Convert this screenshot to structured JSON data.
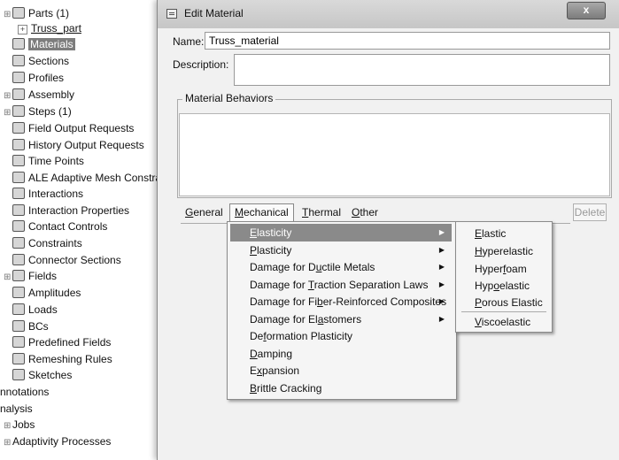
{
  "tree": {
    "items": [
      {
        "label": "Parts (1)",
        "expander": "⊞"
      },
      {
        "label": "Truss_part"
      },
      {
        "label": "Materials"
      },
      {
        "label": "Sections"
      },
      {
        "label": "Profiles"
      },
      {
        "label": "Assembly"
      },
      {
        "label": "Steps (1)"
      },
      {
        "label": "Field Output Requests"
      },
      {
        "label": "History Output Requests"
      },
      {
        "label": "Time Points"
      },
      {
        "label": "ALE Adaptive Mesh Constra"
      },
      {
        "label": "Interactions"
      },
      {
        "label": "Interaction Properties"
      },
      {
        "label": "Contact Controls"
      },
      {
        "label": "Constraints"
      },
      {
        "label": "Connector Sections"
      },
      {
        "label": "Fields"
      },
      {
        "label": "Amplitudes"
      },
      {
        "label": "Loads"
      },
      {
        "label": "BCs"
      },
      {
        "label": "Predefined Fields"
      },
      {
        "label": "Remeshing Rules"
      },
      {
        "label": "Sketches"
      },
      {
        "label": "nnotations"
      },
      {
        "label": "nalysis"
      },
      {
        "label": "Jobs"
      },
      {
        "label": "Adaptivity Processes"
      }
    ]
  },
  "dialog": {
    "title": "Edit Material",
    "close_glyph": "x",
    "name_label": "Name:",
    "name_value": "Truss_material",
    "description_label": "Description:",
    "description_value": "",
    "behaviors_label": "Material Behaviors",
    "menubar": [
      "General",
      "Mechanical",
      "Thermal",
      "Other"
    ],
    "delete_label": "Delete"
  },
  "mechanical_menu": {
    "items": [
      {
        "pre": "",
        "u": "E",
        "post": "lasticity",
        "submenu": true,
        "highlighted": true
      },
      {
        "pre": "",
        "u": "P",
        "post": "lasticity",
        "submenu": true
      },
      {
        "pre": "Damage for D",
        "u": "u",
        "post": "ctile Metals",
        "submenu": true
      },
      {
        "pre": "Damage for ",
        "u": "T",
        "post": "raction Separation Laws",
        "submenu": true
      },
      {
        "pre": "Damage for Fi",
        "u": "b",
        "post": "er-Reinforced Composites",
        "submenu": true
      },
      {
        "pre": "Damage for El",
        "u": "a",
        "post": "stomers",
        "submenu": true
      },
      {
        "pre": "De",
        "u": "f",
        "post": "ormation Plasticity",
        "submenu": false
      },
      {
        "pre": "",
        "u": "D",
        "post": "amping",
        "submenu": false
      },
      {
        "pre": "E",
        "u": "x",
        "post": "pansion",
        "submenu": false
      },
      {
        "pre": "",
        "u": "B",
        "post": "rittle Cracking",
        "submenu": false
      }
    ],
    "arrow_glyph": "▶"
  },
  "elasticity_menu": {
    "items": [
      {
        "pre": "",
        "u": "E",
        "post": "lastic"
      },
      {
        "pre": "",
        "u": "H",
        "post": "yperelastic"
      },
      {
        "pre": "Hyper",
        "u": "f",
        "post": "oam"
      },
      {
        "pre": "Hyp",
        "u": "o",
        "post": "elastic"
      },
      {
        "pre": "",
        "u": "P",
        "post": "orous Elastic"
      },
      {
        "pre": "",
        "u": "V",
        "post": "iscoelastic"
      }
    ]
  }
}
